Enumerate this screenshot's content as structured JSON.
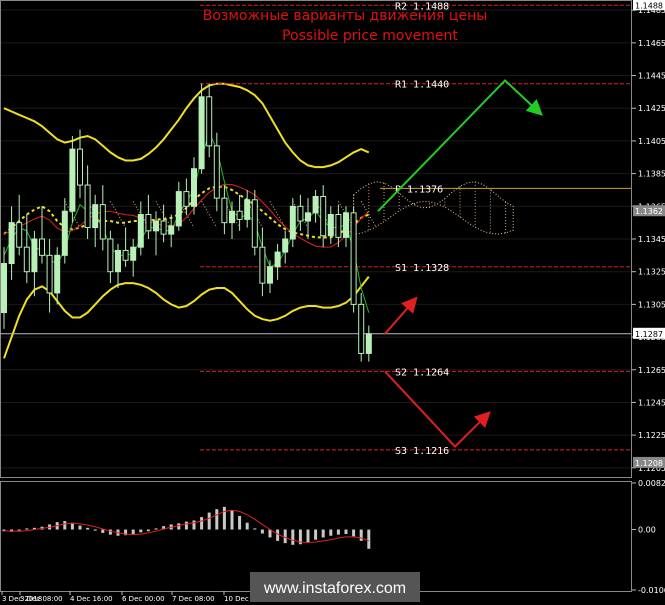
{
  "chart_data": [
    {
      "type": "candlestick",
      "title": "Возможные варианты движения цены",
      "subtitle": "Possible price movement",
      "y_ticks": [
        "1.1485",
        "1.1465",
        "1.1445",
        "1.1425",
        "1.1405",
        "1.1385",
        "1.1365",
        "1.1345",
        "1.1325",
        "1.1305",
        "1.1285",
        "1.1265",
        "1.1245",
        "1.1225",
        "1.1205"
      ],
      "ylim": [
        1.12,
        1.149
      ],
      "x_ticks": [
        "3 Dec 2018",
        "3 Dec 08:00",
        "4 Dec 16:00",
        "6 Dec 00:00",
        "7 Dec 08:00",
        "10 Dec 16:00"
      ],
      "price_tags": [
        {
          "label": "1.1488",
          "value": 1.1488,
          "highlight": false
        },
        {
          "label": "1.1362",
          "value": 1.1362,
          "highlight": true
        },
        {
          "label": "1.1287",
          "value": 1.1287,
          "highlight": false
        },
        {
          "label": "1.1208",
          "value": 1.1208,
          "highlight": true
        }
      ],
      "levels": [
        {
          "label": "R2",
          "value_text": "1.1488",
          "value": 1.1488,
          "color": "#e02020"
        },
        {
          "label": "R1",
          "value_text": "1.1440",
          "value": 1.144,
          "color": "#e02020"
        },
        {
          "label": "P",
          "value_text": "1.1376",
          "value": 1.1376,
          "color": "#d6a020"
        },
        {
          "label": "S1",
          "value_text": "1.1328",
          "value": 1.1328,
          "color": "#e02020"
        },
        {
          "label": "S2",
          "value_text": "1.1264",
          "value": 1.1264,
          "color": "#e02020"
        },
        {
          "label": "S3",
          "value_text": "1.1216",
          "value": 1.1216,
          "color": "#e02020"
        }
      ],
      "candles": [
        [
          1.13,
          1.134,
          1.129,
          1.133
        ],
        [
          1.133,
          1.1365,
          1.132,
          1.1355
        ],
        [
          1.1355,
          1.1372,
          1.1335,
          1.134
        ],
        [
          1.134,
          1.136,
          1.1318,
          1.1325
        ],
        [
          1.1325,
          1.135,
          1.131,
          1.1345
        ],
        [
          1.1345,
          1.1365,
          1.133,
          1.1335
        ],
        [
          1.1335,
          1.1345,
          1.13,
          1.1312
        ],
        [
          1.1312,
          1.134,
          1.1305,
          1.1335
        ],
        [
          1.1335,
          1.137,
          1.133,
          1.1362
        ],
        [
          1.1362,
          1.1408,
          1.1355,
          1.14
        ],
        [
          1.14,
          1.1412,
          1.137,
          1.1378
        ],
        [
          1.1378,
          1.139,
          1.1345,
          1.1352
        ],
        [
          1.1352,
          1.1372,
          1.134,
          1.1366
        ],
        [
          1.1366,
          1.1378,
          1.1338,
          1.1345
        ],
        [
          1.1345,
          1.135,
          1.1318,
          1.1325
        ],
        [
          1.1325,
          1.1342,
          1.1315,
          1.1338
        ],
        [
          1.1338,
          1.1352,
          1.1328,
          1.1332
        ],
        [
          1.1332,
          1.1345,
          1.1322,
          1.134
        ],
        [
          1.134,
          1.1368,
          1.1335,
          1.136
        ],
        [
          1.136,
          1.1372,
          1.1345,
          1.135
        ],
        [
          1.135,
          1.1362,
          1.1335,
          1.1356
        ],
        [
          1.1356,
          1.1366,
          1.1343,
          1.1348
        ],
        [
          1.1348,
          1.136,
          1.134,
          1.1353
        ],
        [
          1.1353,
          1.138,
          1.135,
          1.1374
        ],
        [
          1.1374,
          1.1382,
          1.136,
          1.1365
        ],
        [
          1.1365,
          1.1395,
          1.136,
          1.1388
        ],
        [
          1.1388,
          1.144,
          1.1385,
          1.1432
        ],
        [
          1.1432,
          1.144,
          1.1395,
          1.1402
        ],
        [
          1.1402,
          1.141,
          1.1362,
          1.137
        ],
        [
          1.137,
          1.1378,
          1.1348,
          1.1355
        ],
        [
          1.1355,
          1.1368,
          1.1345,
          1.1362
        ],
        [
          1.1362,
          1.1372,
          1.135,
          1.1357
        ],
        [
          1.1357,
          1.1375,
          1.1352,
          1.1369
        ],
        [
          1.1369,
          1.1375,
          1.1335,
          1.134
        ],
        [
          1.134,
          1.1352,
          1.131,
          1.1318
        ],
        [
          1.1318,
          1.1332,
          1.1312,
          1.1328
        ],
        [
          1.1328,
          1.1342,
          1.132,
          1.1337
        ],
        [
          1.1337,
          1.135,
          1.133,
          1.1345
        ],
        [
          1.1345,
          1.137,
          1.134,
          1.1365
        ],
        [
          1.1365,
          1.1372,
          1.135,
          1.1356
        ],
        [
          1.1356,
          1.137,
          1.1345,
          1.1361
        ],
        [
          1.1361,
          1.1375,
          1.1355,
          1.1371
        ],
        [
          1.1371,
          1.1378,
          1.134,
          1.1347
        ],
        [
          1.1347,
          1.1365,
          1.1342,
          1.136
        ],
        [
          1.136,
          1.1366,
          1.134,
          1.1346
        ],
        [
          1.1346,
          1.1365,
          1.134,
          1.1361
        ],
        [
          1.1361,
          1.1365,
          1.13,
          1.1305
        ],
        [
          1.1305,
          1.1312,
          1.127,
          1.1275
        ],
        [
          1.1275,
          1.1292,
          1.127,
          1.1287
        ]
      ],
      "upper_band": [
        1.1425,
        1.1423,
        1.1421,
        1.1419,
        1.1417,
        1.1414,
        1.141,
        1.1406,
        1.1404,
        1.1405,
        1.1407,
        1.1408,
        1.1406,
        1.1402,
        1.1398,
        1.1395,
        1.1393,
        1.1393,
        1.1394,
        1.1397,
        1.1401,
        1.1406,
        1.1412,
        1.1418,
        1.1425,
        1.1431,
        1.1436,
        1.1439,
        1.144,
        1.144,
        1.1439,
        1.1438,
        1.1436,
        1.1433,
        1.1428,
        1.142,
        1.1412,
        1.1404,
        1.1398,
        1.1393,
        1.139,
        1.1389,
        1.1389,
        1.139,
        1.1392,
        1.1395,
        1.1398,
        1.14,
        1.1398
      ],
      "lower_band": [
        1.1272,
        1.1285,
        1.1298,
        1.1308,
        1.1314,
        1.1316,
        1.1313,
        1.1307,
        1.1301,
        1.1297,
        1.1297,
        1.13,
        1.1305,
        1.131,
        1.1314,
        1.1317,
        1.1318,
        1.1318,
        1.1317,
        1.1315,
        1.1312,
        1.1308,
        1.1305,
        1.1303,
        1.1304,
        1.1307,
        1.1311,
        1.1314,
        1.1315,
        1.1315,
        1.1312,
        1.1307,
        1.1302,
        1.1298,
        1.1296,
        1.1295,
        1.1296,
        1.1298,
        1.1301,
        1.1303,
        1.1304,
        1.1304,
        1.1303,
        1.1303,
        1.1304,
        1.1306,
        1.131,
        1.1316,
        1.1322
      ],
      "middle_band": [
        1.1348,
        1.1352,
        1.1356,
        1.136,
        1.1363,
        1.1365,
        1.1362,
        1.1356,
        1.1352,
        1.1351,
        1.1352,
        1.1354,
        1.1356,
        1.1356,
        1.1356,
        1.1355,
        1.1355,
        1.1356,
        1.1356,
        1.1356,
        1.1357,
        1.1357,
        1.1358,
        1.136,
        1.1364,
        1.1369,
        1.1373,
        1.1376,
        1.1377,
        1.1377,
        1.1375,
        1.1372,
        1.1369,
        1.1366,
        1.1362,
        1.1358,
        1.1354,
        1.1351,
        1.1349,
        1.1348,
        1.1347,
        1.1346,
        1.1346,
        1.1346,
        1.1348,
        1.1351,
        1.1354,
        1.1358,
        1.136
      ],
      "ma_green": [
        1.1335,
        1.1345,
        1.1352,
        1.135,
        1.134,
        1.1338,
        1.1332,
        1.133,
        1.1338,
        1.1355,
        1.1366,
        1.1362,
        1.136,
        1.1352,
        1.134,
        1.1335,
        1.1335,
        1.1336,
        1.1345,
        1.1352,
        1.1352,
        1.135,
        1.135,
        1.136,
        1.1368,
        1.1375,
        1.1395,
        1.141,
        1.14,
        1.138,
        1.1362,
        1.1358,
        1.136,
        1.1355,
        1.134,
        1.1328,
        1.133,
        1.1338,
        1.1348,
        1.1356,
        1.1358,
        1.1362,
        1.1356,
        1.1352,
        1.1352,
        1.1354,
        1.1338,
        1.1315,
        1.13
      ],
      "projections": [
        {
          "color": "#22cc22",
          "points": [
            [
              1.1362
            ],
            [
              1.1442
            ],
            [
              1.1422
            ]
          ]
        },
        {
          "color": "#e02020",
          "points": [
            [
              1.1287
            ],
            [
              1.1308
            ]
          ]
        },
        {
          "color": "#e02020",
          "points": [
            [
              1.1264
            ],
            [
              1.1218
            ],
            [
              1.1238
            ]
          ]
        }
      ]
    },
    {
      "type": "bar",
      "title": "",
      "y_ticks": [
        "0.00822",
        "0.00",
        "-0.01068"
      ],
      "ylim": [
        -0.01068,
        0.00822
      ],
      "values": [
        -0.0003,
        -0.0004,
        -0.0002,
        0.0002,
        0.0003,
        0.0005,
        0.0009,
        0.0013,
        0.0015,
        0.0012,
        0.0007,
        0.0003,
        -0.0002,
        -0.0006,
        -0.0009,
        -0.0011,
        -0.001,
        -0.0008,
        -0.0005,
        -0.0003,
        0.0002,
        0.0006,
        0.0009,
        0.0011,
        0.0014,
        0.0016,
        0.0022,
        0.003,
        0.0036,
        0.004,
        0.0034,
        0.0024,
        0.0012,
        0.0002,
        -0.0007,
        -0.0014,
        -0.002,
        -0.0024,
        -0.0027,
        -0.0026,
        -0.0022,
        -0.0018,
        -0.0014,
        -0.0011,
        -0.0009,
        -0.0008,
        -0.0012,
        -0.002,
        -0.0034
      ],
      "signal": [
        -0.0002,
        -0.0003,
        -0.0003,
        -0.0002,
        0.0,
        0.0002,
        0.0004,
        0.0007,
        0.001,
        0.0011,
        0.001,
        0.0008,
        0.0005,
        0.0001,
        -0.0003,
        -0.0006,
        -0.0008,
        -0.0009,
        -0.0008,
        -0.0006,
        -0.0003,
        0.0001,
        0.0004,
        0.0007,
        0.001,
        0.0012,
        0.0015,
        0.002,
        0.0026,
        0.0032,
        0.0034,
        0.0032,
        0.0026,
        0.0018,
        0.0009,
        0.0,
        -0.0008,
        -0.0014,
        -0.0019,
        -0.0022,
        -0.0023,
        -0.0022,
        -0.002,
        -0.0018,
        -0.0015,
        -0.0013,
        -0.0013,
        -0.0015,
        -0.002
      ]
    }
  ],
  "watermark": "www.instaforex.com"
}
